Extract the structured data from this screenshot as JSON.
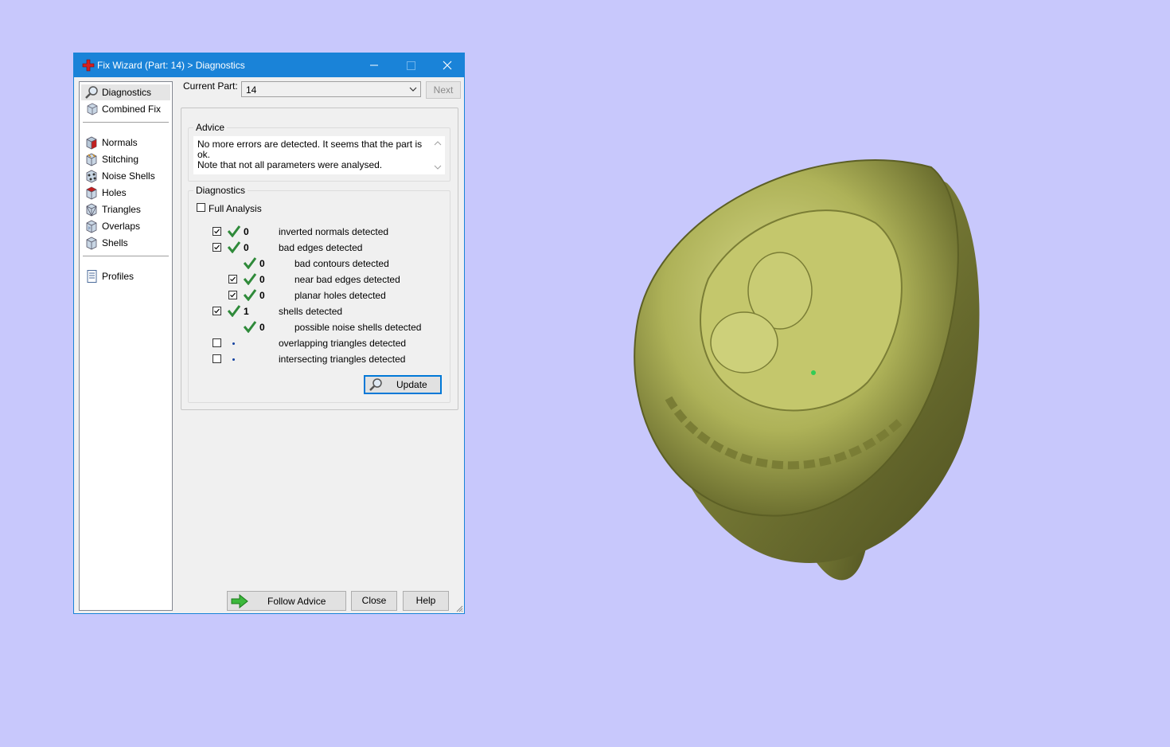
{
  "window": {
    "title": "Fix Wizard (Part: 14) > Diagnostics"
  },
  "sidebar": {
    "items": [
      {
        "label": "Diagnostics"
      },
      {
        "label": "Combined Fix"
      },
      {
        "label": "Normals"
      },
      {
        "label": "Stitching"
      },
      {
        "label": "Noise Shells"
      },
      {
        "label": "Holes"
      },
      {
        "label": "Triangles"
      },
      {
        "label": "Overlaps"
      },
      {
        "label": "Shells"
      },
      {
        "label": "Profiles"
      }
    ]
  },
  "current_part": {
    "label": "Current Part:",
    "value": "14",
    "next_label": "Next"
  },
  "advice": {
    "title": "Advice",
    "line1": "No more errors are detected. It seems that the part is ok.",
    "line2": "Note that not all parameters were analysed."
  },
  "diagnostics": {
    "title": "Diagnostics",
    "full_analysis": "Full Analysis",
    "rows": [
      {
        "count": "0",
        "label": "inverted normals detected"
      },
      {
        "count": "0",
        "label": "bad edges detected"
      },
      {
        "count": "0",
        "label": "bad contours detected"
      },
      {
        "count": "0",
        "label": "near bad edges detected"
      },
      {
        "count": "0",
        "label": "planar holes detected"
      },
      {
        "count": "1",
        "label": "shells detected"
      },
      {
        "count": "0",
        "label": "possible noise shells detected"
      },
      {
        "count": "",
        "label": "overlapping triangles detected"
      },
      {
        "count": "",
        "label": "intersecting triangles detected"
      }
    ],
    "update_label": "Update"
  },
  "footer": {
    "follow_advice": "Follow Advice",
    "close": "Close",
    "help": "Help"
  },
  "colors": {
    "titlebar": "#1a83d8",
    "desktop": "#c8c8fc",
    "check_green": "#2f8a3a",
    "model": "#b0b45a"
  }
}
